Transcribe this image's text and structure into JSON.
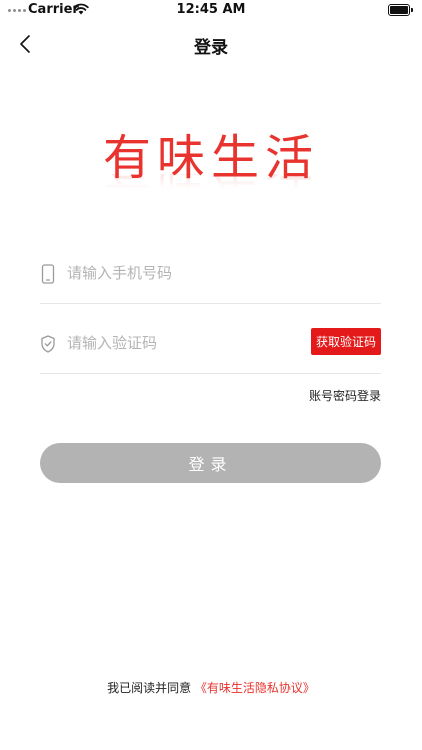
{
  "status_bar": {
    "carrier": "Carrier",
    "time": "12:45 AM"
  },
  "nav": {
    "title": "登录"
  },
  "logo": {
    "text": "有味生活",
    "color": "#e8332e"
  },
  "form": {
    "phone_placeholder": "请输入手机号码",
    "code_placeholder": "请输入验证码",
    "get_code_label": "获取验证码",
    "password_login_label": "账号密码登录",
    "login_label": "登录"
  },
  "agreement": {
    "prefix": "我已阅读并同意",
    "link": "《有味生活隐私协议》"
  },
  "colors": {
    "accent": "#e41a1a",
    "login_disabled": "#b3b3b3"
  }
}
